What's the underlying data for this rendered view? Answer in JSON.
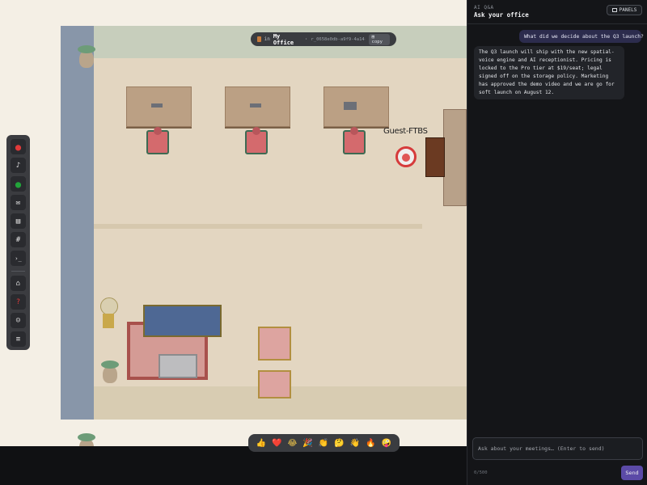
{
  "room": {
    "prefix": "in",
    "name": "My Office",
    "id": "r_0658e0db-a9f9-4a14-…",
    "copy_label": "copy"
  },
  "map": {
    "guest_label": "Guest-FTBS"
  },
  "toolbar": {
    "items": [
      {
        "name": "record",
        "glyph": "●",
        "color": "#e03a3a"
      },
      {
        "name": "microphone",
        "glyph": "🎙"
      },
      {
        "name": "camera",
        "glyph": "●",
        "color": "#22a33a"
      },
      {
        "name": "chat",
        "glyph": "💬"
      },
      {
        "name": "notes",
        "glyph": "📋"
      },
      {
        "name": "channels",
        "glyph": "#"
      },
      {
        "name": "terminal",
        "glyph": ">_"
      },
      {
        "name": "games",
        "glyph": "🎮"
      },
      {
        "name": "help",
        "glyph": "?",
        "color": "#e03a3a"
      },
      {
        "name": "assistant",
        "glyph": "🤖"
      },
      {
        "name": "menu",
        "glyph": "≡"
      }
    ]
  },
  "emojis": [
    "👍",
    "❤️",
    "😂",
    "🎉",
    "👏",
    "🤔",
    "👋",
    "🔥",
    "🤪"
  ],
  "panel": {
    "kicker": "AI Q&A",
    "title": "Ask your office",
    "panels_label": "PANELS",
    "user_message": "What did we decide about the Q3 launch?",
    "bot_message": "The Q3 launch will ship with the new spatial-voice engine and AI receptionist. Pricing is locked to the Pro tier at $19/seat; legal signed off on the storage policy. Marketing has approved the demo video and we are go for soft launch on August 12.",
    "input_placeholder": "Ask about your meetings… (Enter to send)",
    "counter": "0/500",
    "send_label": "Send"
  },
  "colors": {
    "accent": "#5b4aa7",
    "user_bubble": "#2c2c4d",
    "guest_ring": "#d63b3b"
  }
}
